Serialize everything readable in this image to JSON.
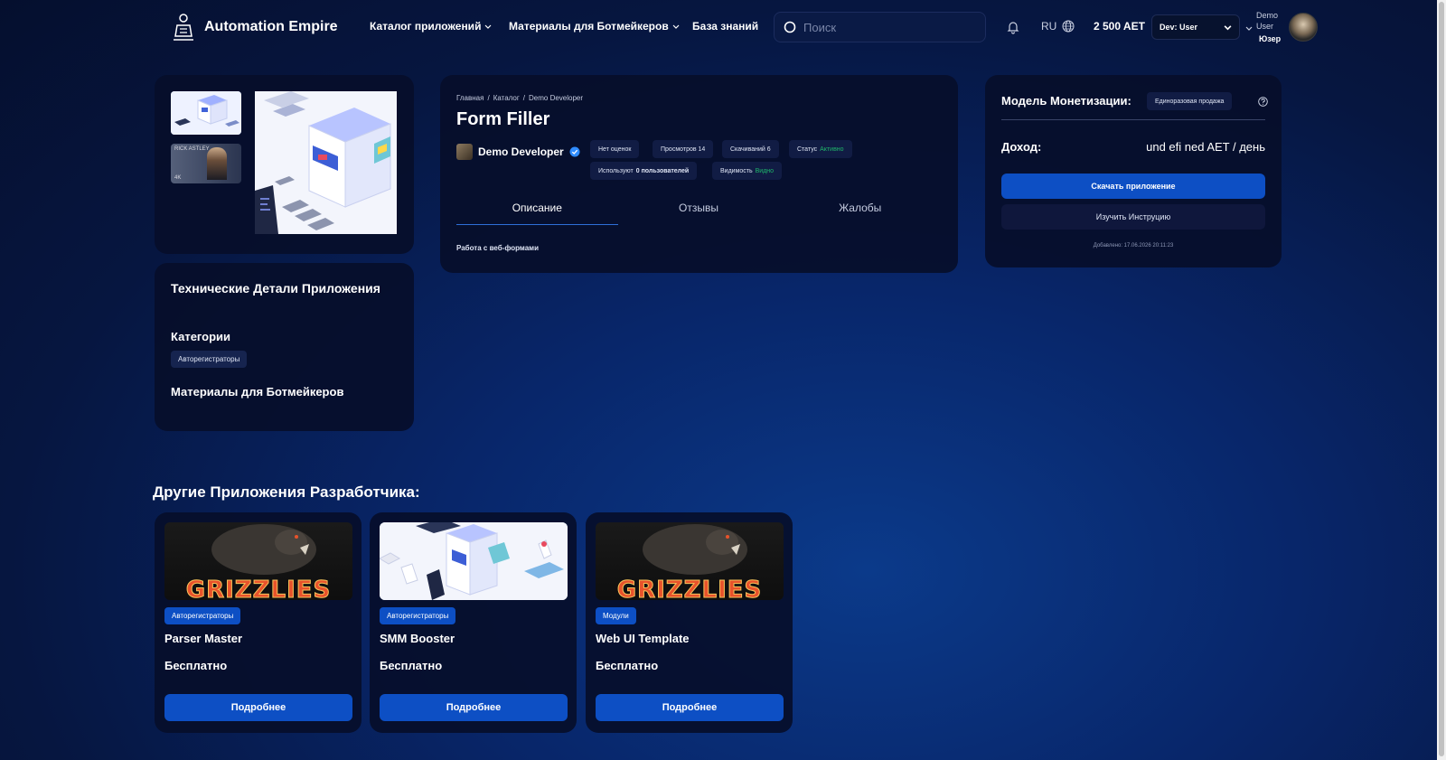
{
  "header": {
    "brand": "Automation Empire",
    "nav": [
      {
        "label": "Каталог приложений"
      },
      {
        "label": "Материалы для Ботмейкеров"
      },
      {
        "label": "База знаний"
      }
    ],
    "search_placeholder": "Поиск",
    "lang": "RU",
    "balance": "2 500 AET",
    "role_select": "Dev: User",
    "user_name": "Demo User",
    "user_role": "Юзер"
  },
  "tech": {
    "title": "Технические Детали Приложения",
    "categories_title": "Категории",
    "category_tag": "Авторегистраторы",
    "materials_title": "Материалы для Ботмейкеров"
  },
  "gallery": {
    "thumb2_text": "RICK ASTLEY",
    "thumb2_badge": "4K"
  },
  "app": {
    "breadcrumbs": [
      "Главная",
      "/",
      "Каталог",
      "/",
      "Demo Developer"
    ],
    "title": "Form Filler",
    "developer": "Demo Developer",
    "stats": {
      "rating": "Нет оценок",
      "views": "Просмотров 14",
      "downloads": "Скачиваний 6",
      "status_label": "Статус",
      "status_value": "Активно",
      "users_label": "Используют",
      "users_value": "0 пользователей",
      "visibility_label": "Видимость",
      "visibility_value": "Видно"
    },
    "tabs": [
      "Описание",
      "Отзывы",
      "Жалобы"
    ],
    "description": "Работа с веб-формами"
  },
  "monetization": {
    "title": "Модель Монетизации:",
    "badge": "Единоразовая продажа",
    "income_label": "Доход:",
    "income_value": "und efi ned AET / день",
    "download_button": "Скачать приложение",
    "instruction_button": "Изучить Инструцию",
    "added": "Добавлено: 17.06.2026 20:11:23"
  },
  "other_apps": {
    "title": "Другие Приложения Разработчика:",
    "items": [
      {
        "tag": "Авторегистраторы",
        "name": "Parser Master",
        "price": "Бесплатно",
        "button": "Подробнее",
        "image_text": "GRIZZLIES"
      },
      {
        "tag": "Авторегистраторы",
        "name": "SMM Booster",
        "price": "Бесплатно",
        "button": "Подробнее",
        "image_text": ""
      },
      {
        "tag": "Модули",
        "name": "Web UI Template",
        "price": "Бесплатно",
        "button": "Подробнее",
        "image_text": "GRIZZLIES"
      }
    ]
  },
  "colors": {
    "accent": "#0d4fc4",
    "status_green": "#1fb56a",
    "background": "#061640"
  }
}
